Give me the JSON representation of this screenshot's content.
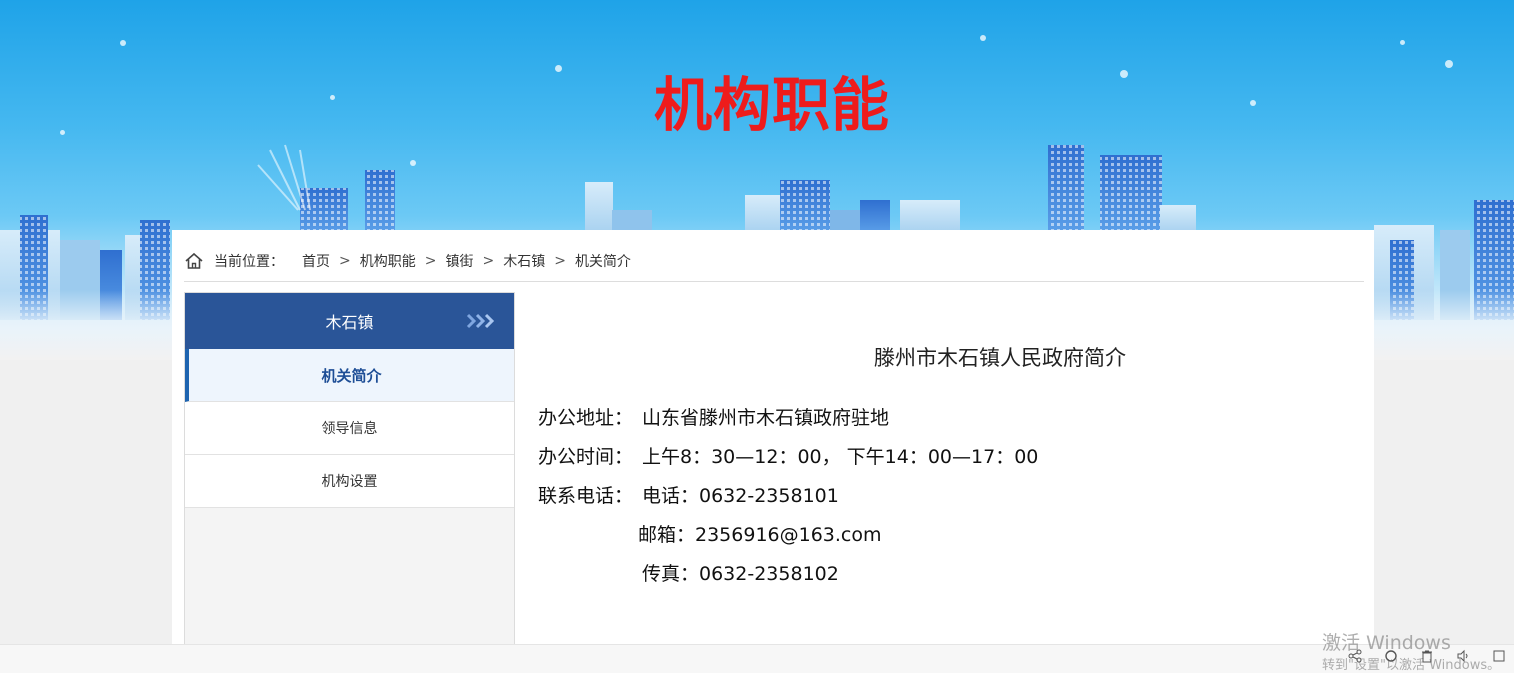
{
  "banner": {
    "title": "机构职能"
  },
  "breadcrumb": {
    "label": "当前位置：",
    "items": [
      "首页",
      "机构职能",
      "镇街",
      "木石镇",
      "机关简介"
    ],
    "separator": ">"
  },
  "sidebar": {
    "title": "木石镇",
    "items": [
      {
        "label": "机关简介",
        "active": true
      },
      {
        "label": "领导信息",
        "active": false
      },
      {
        "label": "机构设置",
        "active": false
      }
    ]
  },
  "content": {
    "heading": "滕州市木石镇人民政府简介",
    "address_label": "办公地址：",
    "address_value": "山东省滕州市木石镇政府驻地",
    "hours_label": "办公时间：",
    "hours_value": "上午8：30—12：00， 下午14：00—17：00",
    "contact_label": "联系电话：",
    "phone_value": "电话：0632-2358101",
    "email_value": "邮箱：2356916@163.com",
    "fax_value": "传真：0632-2358102"
  },
  "watermark": {
    "line1": "激活 Windows",
    "line2": "转到\"设置\"以激活 Windows。"
  },
  "colors": {
    "title_red": "#ee1c1c",
    "sidebar_head": "#2a5598",
    "active_item_text": "#1e4e96",
    "active_item_bar": "#1e64b0"
  }
}
